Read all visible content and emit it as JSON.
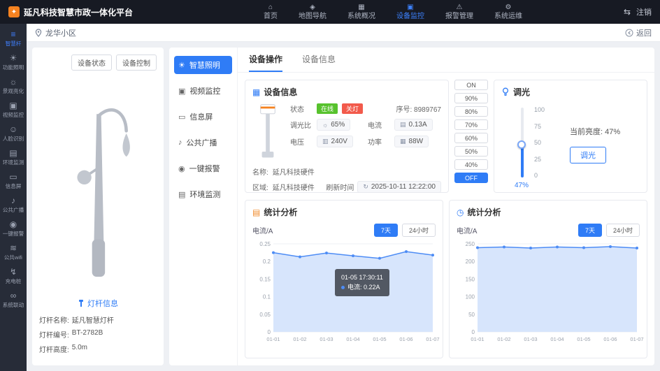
{
  "topbar": {
    "title": "延凡科技智慧市政一体化平台",
    "logo_glyph": "✦",
    "nav": [
      {
        "label": "首页",
        "icon": "⌂",
        "active": false
      },
      {
        "label": "地图导航",
        "icon": "◈",
        "active": false
      },
      {
        "label": "系统概况",
        "icon": "▦",
        "active": false
      },
      {
        "label": "设备监控",
        "icon": "▣",
        "active": true
      },
      {
        "label": "报警管理",
        "icon": "⚠",
        "active": false
      },
      {
        "label": "系统运维",
        "icon": "⚙",
        "active": false
      }
    ],
    "switch_icon": "⇆",
    "logout": "注销"
  },
  "subheader": {
    "location": "龙华小区",
    "back": "返回"
  },
  "sidebar": {
    "items": [
      {
        "label": "智慧杆",
        "icon": "≡",
        "active": true
      },
      {
        "label": "功能照明",
        "icon": "☀",
        "active": false
      },
      {
        "label": "景观亮化",
        "icon": "☼",
        "active": false
      },
      {
        "label": "视频监控",
        "icon": "▣",
        "active": false
      },
      {
        "label": "人脸识别",
        "icon": "☺",
        "active": false
      },
      {
        "label": "环境监测",
        "icon": "▤",
        "active": false
      },
      {
        "label": "信息屏",
        "icon": "▭",
        "active": false
      },
      {
        "label": "公共广播",
        "icon": "♪",
        "active": false
      },
      {
        "label": "一键报警",
        "icon": "◉",
        "active": false
      },
      {
        "label": "公共wifi",
        "icon": "≋",
        "active": false
      },
      {
        "label": "充电桩",
        "icon": "↯",
        "active": false
      },
      {
        "label": "系统联动",
        "icon": "∞",
        "active": false
      }
    ]
  },
  "pole_panel": {
    "status_button": "设备状态",
    "control_button": "设备控制",
    "info_title": "灯杆信息",
    "fields": [
      {
        "label": "灯杆名称:",
        "value": "延凡智慧灯杆"
      },
      {
        "label": "灯杆编号:",
        "value": "BT-2782B"
      },
      {
        "label": "灯杆高度:",
        "value": "5.0m"
      }
    ]
  },
  "menu": {
    "items": [
      {
        "label": "智慧照明",
        "icon": "☀",
        "active": true
      },
      {
        "label": "视频监控",
        "icon": "▣",
        "active": false
      },
      {
        "label": "信息屏",
        "icon": "▭",
        "active": false
      },
      {
        "label": "公共广播",
        "icon": "♪",
        "active": false
      },
      {
        "label": "一键报警",
        "icon": "◉",
        "active": false
      },
      {
        "label": "环境监测",
        "icon": "▤",
        "active": false
      }
    ]
  },
  "tabs": {
    "operation": "设备操作",
    "info": "设备信息"
  },
  "device_info": {
    "title": "设备信息",
    "status_label": "状态",
    "online": "在线",
    "light_off": "关灯",
    "serial": "序号: 8989767",
    "dim_label": "调光比",
    "dim_icon": "☼",
    "dim_value": "65%",
    "current_label": "电流",
    "current_icon": "▤",
    "current_value": "0.13A",
    "voltage_label": "电压",
    "voltage_icon": "▥",
    "voltage_value": "240V",
    "power_label": "功率",
    "power_icon": "▦",
    "power_value": "88W",
    "name_label": "名称:",
    "name_value": "延凡科技硬件",
    "area_label": "区域:",
    "area_value": "延凡科技硬件",
    "refresh_label": "刷新时间",
    "refresh_icon": "↻",
    "refresh_value": "2025-10-11 12:22:00"
  },
  "power_buttons": {
    "items": [
      {
        "label": "ON",
        "active": false
      },
      {
        "label": "90%",
        "active": false
      },
      {
        "label": "80%",
        "active": false
      },
      {
        "label": "70%",
        "active": false
      },
      {
        "label": "60%",
        "active": false
      },
      {
        "label": "50%",
        "active": false
      },
      {
        "label": "40%",
        "active": false
      },
      {
        "label": "OFF",
        "active": true
      }
    ]
  },
  "dimming": {
    "title": "调光",
    "scale": [
      "100",
      "75",
      "50",
      "25",
      "0"
    ],
    "percent": "47%",
    "current_text": "当前亮度: 47%",
    "button": "调光"
  },
  "colors": {
    "accent_blue": "#2f7cf6",
    "online_green": "#57c22d",
    "off_red": "#f25a4b",
    "chart_line": "#4d8cf5",
    "chart_fill": "#d7e5fc"
  },
  "chart_data": [
    {
      "type": "area",
      "title": "统计分析",
      "icon": "▤",
      "ylabel": "电流/A",
      "range_buttons": [
        "7天",
        "24小时"
      ],
      "active_range": "7天",
      "x": [
        "01-01",
        "01-02",
        "01-03",
        "01-04",
        "01-05",
        "01-06",
        "01-07"
      ],
      "values": [
        0.225,
        0.213,
        0.224,
        0.216,
        0.209,
        0.228,
        0.218
      ],
      "ylim": [
        0,
        0.25
      ],
      "yticks": [
        0,
        0.05,
        0.1,
        0.15,
        0.2,
        0.25
      ],
      "grid": true,
      "legend": false,
      "tooltip": {
        "time": "01-05 17:30:11",
        "text": "电流: 0.22A"
      }
    },
    {
      "type": "area",
      "title": "统计分析",
      "icon": "◷",
      "ylabel": "电流/A",
      "range_buttons": [
        "7天",
        "24小时"
      ],
      "active_range": "7天",
      "x": [
        "01-01",
        "01-02",
        "01-03",
        "01-04",
        "01-05",
        "01-06",
        "01-07"
      ],
      "values": [
        239,
        241,
        238,
        241,
        239,
        242,
        238
      ],
      "ylim": [
        0,
        250
      ],
      "yticks": [
        0,
        50,
        100,
        150,
        200,
        250
      ],
      "grid": true,
      "legend": false
    }
  ]
}
